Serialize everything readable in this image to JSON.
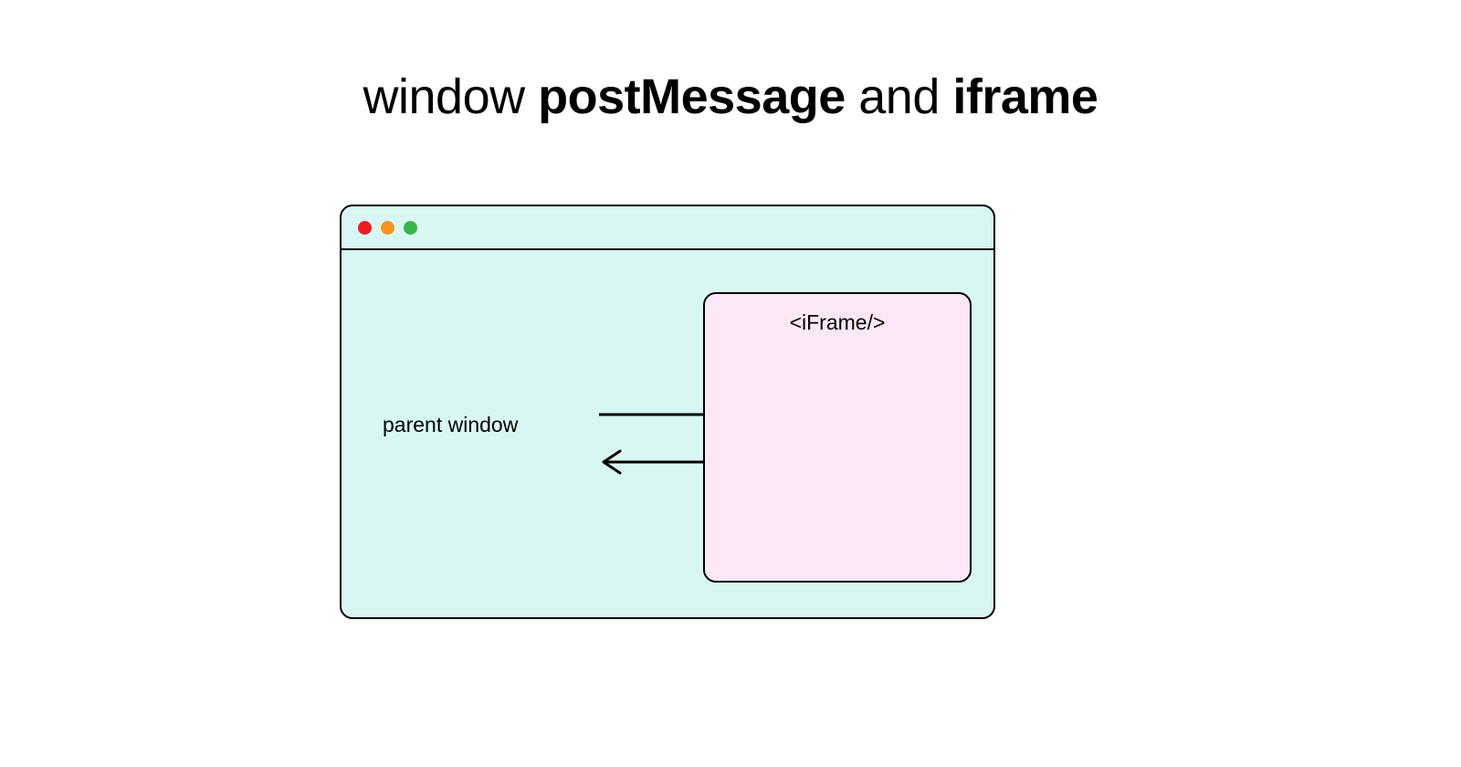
{
  "title": {
    "part1": "window ",
    "part2": "postMessage",
    "part3": " and ",
    "part4": "iframe"
  },
  "diagram": {
    "parent_label": "parent window",
    "iframe_label": "<iFrame/>"
  }
}
